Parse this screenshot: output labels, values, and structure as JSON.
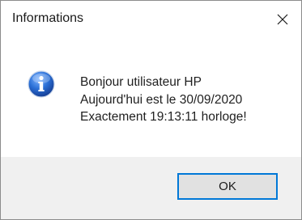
{
  "window": {
    "title": "Informations",
    "close_icon": "close-icon"
  },
  "message": {
    "icon": "info-icon",
    "lines": [
      "Bonjour utilisateur HP",
      "Aujourd'hui est le 30/09/2020",
      "Exactement 19:13:11 horloge!"
    ]
  },
  "footer": {
    "ok_label": "OK"
  },
  "colors": {
    "accent": "#0078d7",
    "footer_bg": "#f0f0f0",
    "icon_blue": "#2a6fd6"
  }
}
